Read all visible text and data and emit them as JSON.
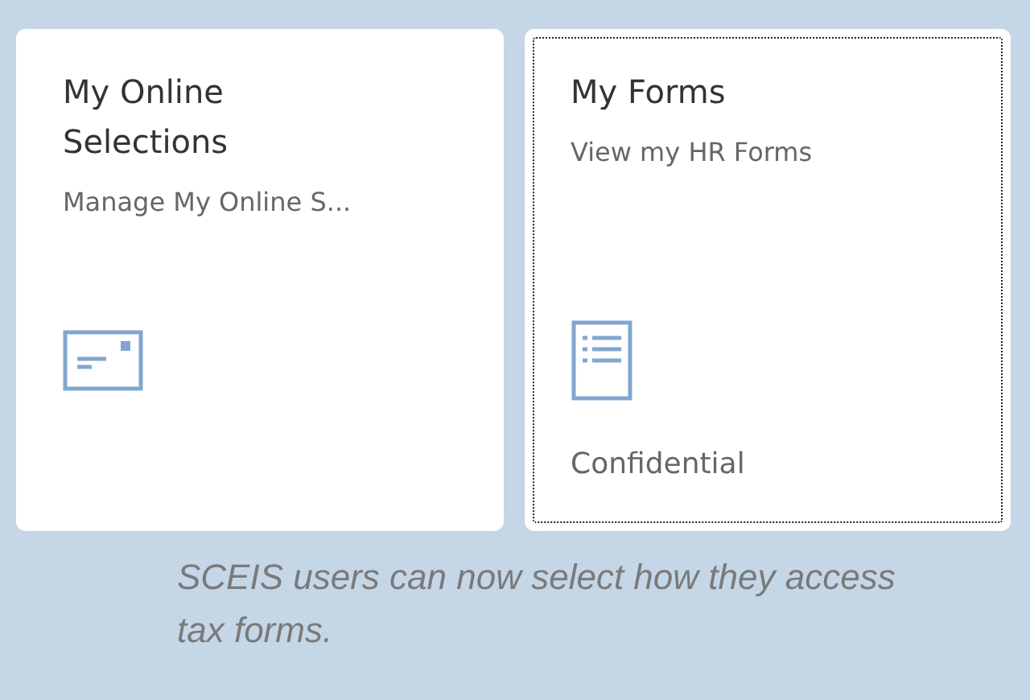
{
  "tiles": [
    {
      "kind": "card",
      "title": "My Online Selections",
      "subtitle": "Manage My Online S...",
      "focused": false
    },
    {
      "kind": "list",
      "title": "My Forms",
      "subtitle": "View my HR Forms",
      "footer": "Confidential",
      "focused": true
    }
  ],
  "caption": "SCEIS users can now select how they access tax forms."
}
